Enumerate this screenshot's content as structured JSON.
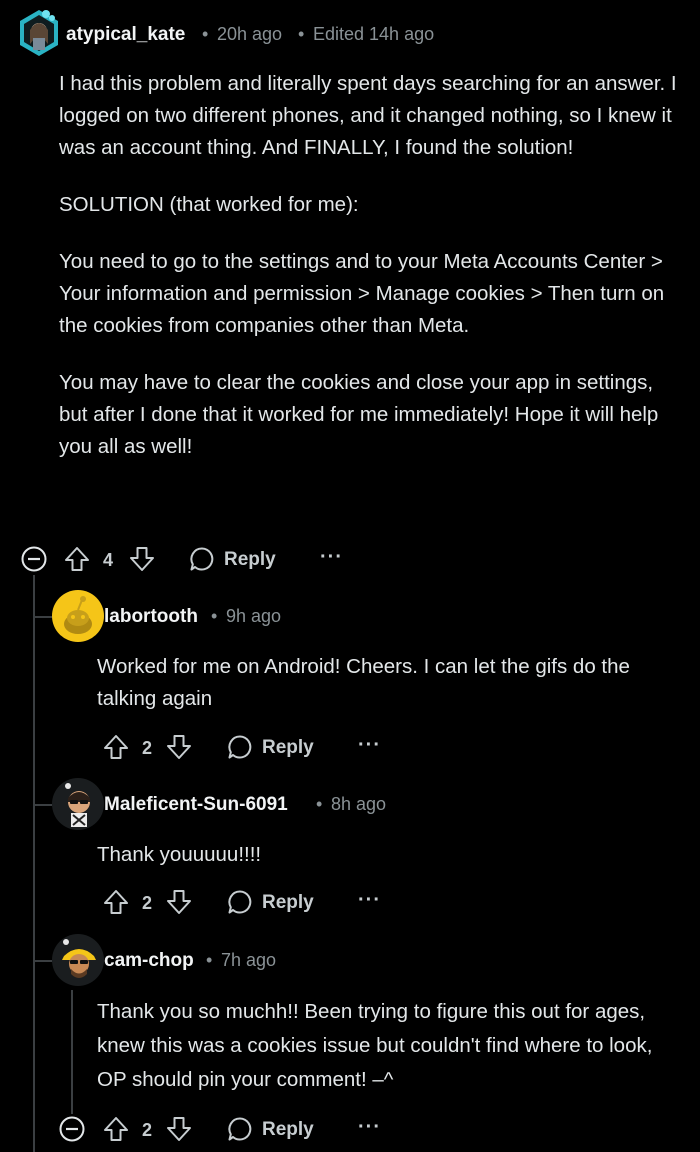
{
  "comments": [
    {
      "username": "atypical_kate",
      "time": "20h ago",
      "edited": "Edited 14h ago",
      "paragraphs": [
        "I had this problem and literally spent days searching for an answer. I logged on two different phones, and it changed nothing, so I knew it was an account thing. And FINALLY, I found the solution!",
        "SOLUTION (that worked for me):",
        "You need to go to the settings and to your Meta Accounts Center > Your information and permission > Manage cookies > Then turn on the cookies from companies other than Meta.",
        "You may have to clear the cookies and close your app in settings, but after I done that it worked for me immediately! Hope it will help you all as well!"
      ],
      "votes": "4",
      "reply": "Reply",
      "more": "···"
    },
    {
      "username": "labortooth",
      "time": "9h ago",
      "paragraphs": [
        "Worked for me on Android! Cheers. I can let the gifs do the talking again"
      ],
      "votes": "2",
      "reply": "Reply",
      "more": "···"
    },
    {
      "username": "Maleficent-Sun-6091",
      "time": "8h ago",
      "paragraphs": [
        "Thank youuuuu!!!!"
      ],
      "votes": "2",
      "reply": "Reply",
      "more": "···"
    },
    {
      "username": "cam-chop",
      "time": "7h ago",
      "paragraphs": [
        "Thank you so muchh!! Been trying to figure this out for ages, knew this was a cookies issue but couldn't find where to look, OP should pin your comment! –^"
      ],
      "votes": "2",
      "reply": "Reply",
      "more": "···"
    }
  ],
  "separator": "•",
  "icons": {
    "collapse": "collapse-icon",
    "upvote": "upvote-icon",
    "downvote": "downvote-icon",
    "reply": "reply-bubble-icon",
    "more": "more-options-icon"
  },
  "colors": {
    "background": "#000000",
    "text": "#e3e7e9",
    "meta": "#8a9296",
    "thread_line": "#3b3f42",
    "avatar_yellow": "#f5c518",
    "avatar_teal": "#2ab3c4"
  }
}
